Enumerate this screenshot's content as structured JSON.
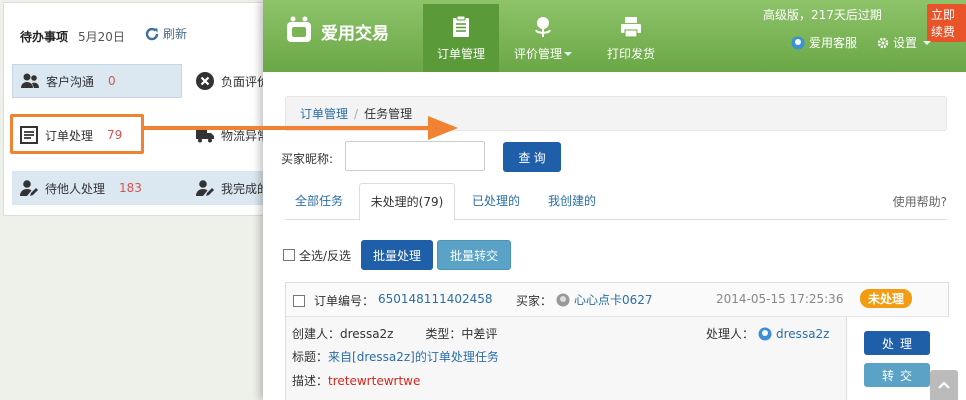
{
  "todo": {
    "title": "待办事项",
    "date": "5月20日",
    "refresh_label": "刷新",
    "items": [
      {
        "label": "客户沟通",
        "count": "0",
        "icon": "users-icon"
      },
      {
        "label": "负面评价",
        "icon": "x-circle-icon"
      },
      {
        "label": "订单处理",
        "count": "79",
        "icon": "list-icon"
      },
      {
        "label": "物流异常",
        "icon": "truck-icon"
      },
      {
        "label": "待他人处理",
        "count": "183",
        "icon": "user-edit-icon"
      },
      {
        "label": "我完成的",
        "icon": "user-edit-icon"
      }
    ]
  },
  "app": {
    "logo_text": "爱用交易",
    "nav": {
      "orders": "订单管理",
      "reviews": "评价管理",
      "print": "打印发货"
    },
    "edition_text": "高级版，217天后过期",
    "renew_label": "立即续费",
    "service_label": "爱用客服",
    "settings_label": "设置"
  },
  "breadcrumb": {
    "parent": "订单管理",
    "separator": "/",
    "current": "任务管理"
  },
  "search": {
    "label": "买家昵称:",
    "value": "",
    "placeholder": "",
    "button": "查 询"
  },
  "tabs": {
    "all": "全部任务",
    "pending": "未处理的(79)",
    "done": "已处理的",
    "created": "我创建的",
    "help": "使用帮助?"
  },
  "bulk": {
    "select_label": "全选/反选",
    "batch_process": "批量处理",
    "batch_transfer": "批量转交"
  },
  "task": {
    "order_label": "订单编号：",
    "order_no": "650148111402458",
    "buyer_label": "买家：",
    "buyer_name": "心心点卡0627",
    "time": "2014-05-15 17:25:36",
    "status": "未处理",
    "creator_label": "创建人：",
    "creator": "dressa2z",
    "type_label": "类型：",
    "type": "中差评",
    "handler_label": "处理人：",
    "handler": "dressa2z",
    "title_label": "标题：",
    "title": "来自[dressa2z]的订单处理任务",
    "desc_label": "描述：",
    "desc": "tretewrtewrtwe",
    "btn_handle": "处理",
    "btn_transfer": "转交"
  },
  "colors": {
    "header_green": "#7ab555",
    "primary_blue": "#1f5ea8",
    "teal": "#5aa3c6",
    "annotation_orange": "#f08232",
    "badge_orange": "#f39c12",
    "count_red": "#d9534f"
  }
}
